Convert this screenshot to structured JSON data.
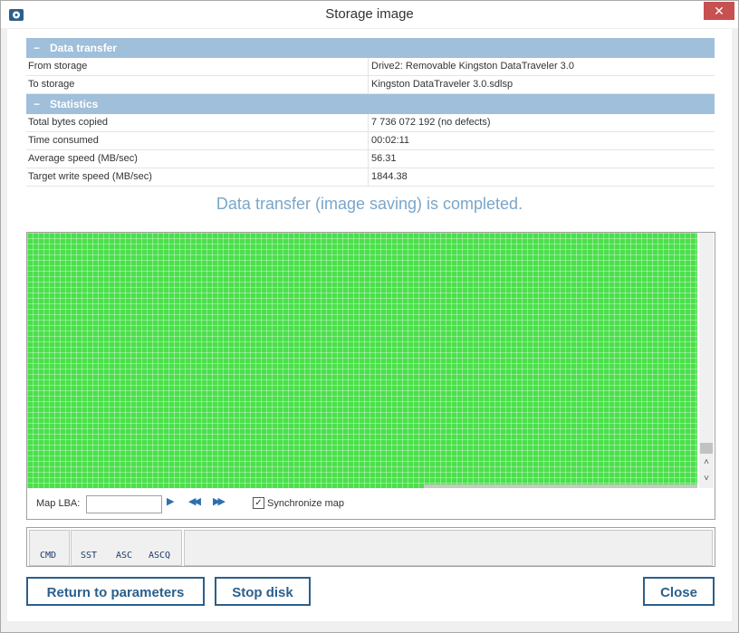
{
  "window": {
    "title": "Storage image",
    "close_icon_label": "✕"
  },
  "data_transfer": {
    "header": "Data transfer",
    "toggle": "−",
    "rows": [
      {
        "label": "From storage",
        "value": "Drive2: Removable Kingston DataTraveler 3.0"
      },
      {
        "label": "To storage",
        "value": "Kingston DataTraveler 3.0.sdlsp"
      }
    ]
  },
  "statistics": {
    "header": "Statistics",
    "toggle": "−",
    "rows": [
      {
        "label": "Total bytes copied",
        "value": "7 736 072 192 (no defects)"
      },
      {
        "label": "Time consumed",
        "value": "00:02:11"
      },
      {
        "label": "Average speed (MB/sec)",
        "value": "56.31"
      },
      {
        "label": "Target write speed (MB/sec)",
        "value": "1844.38"
      }
    ]
  },
  "status_message": "Data transfer (image saving) is completed.",
  "map": {
    "lba_label": "Map LBA:",
    "lba_value": "",
    "sync_label": "Synchronize map",
    "sync_checked_glyph": "✓",
    "play_glyph": "▶",
    "rewind_glyph": "◀◀",
    "forward_glyph": "▶▶",
    "scroll_up_glyph": "˄",
    "scroll_down_glyph": "˅",
    "good_color": "#4be04b"
  },
  "registers": {
    "cmd": "CMD",
    "sst": "SST",
    "asc": "ASC",
    "ascq": "ASCQ"
  },
  "buttons": {
    "return": "Return to parameters",
    "stop": "Stop disk",
    "close": "Close"
  }
}
